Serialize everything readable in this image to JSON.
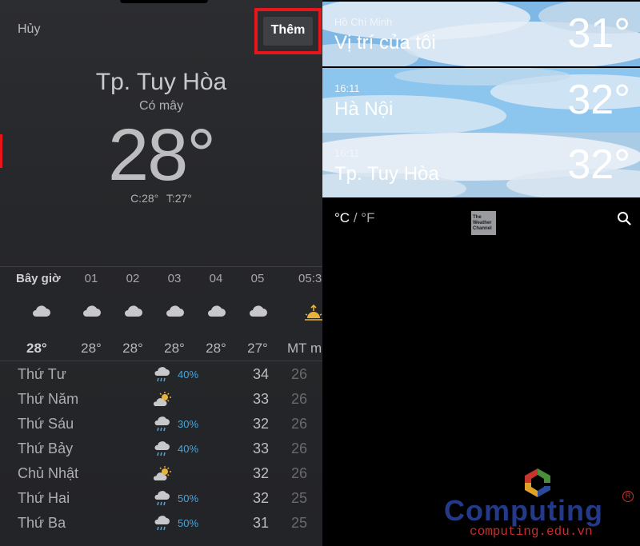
{
  "left_panel": {
    "cancel_label": "Hủy",
    "add_label": "Thêm",
    "city": "Tp. Tuy Hòa",
    "condition": "Có mây",
    "current_temp": "28°",
    "hi_lo": "C:28°  T:27°",
    "hourly": [
      {
        "label": "Bây giờ",
        "icon": "cloud-icon",
        "temp": "28°"
      },
      {
        "label": "01",
        "icon": "cloud-icon",
        "temp": "28°"
      },
      {
        "label": "02",
        "icon": "cloud-icon",
        "temp": "28°"
      },
      {
        "label": "03",
        "icon": "cloud-icon",
        "temp": "28°"
      },
      {
        "label": "04",
        "icon": "cloud-icon",
        "temp": "28°"
      },
      {
        "label": "05",
        "icon": "cloud-icon",
        "temp": "27°"
      },
      {
        "label": "05:3",
        "icon": "sunrise-icon",
        "temp": "MT m"
      }
    ],
    "daily": [
      {
        "day": "Thứ Tư",
        "icon": "rain-icon",
        "precip": "40%",
        "high": "34",
        "low": "26"
      },
      {
        "day": "Thứ Năm",
        "icon": "sun-cloud-icon",
        "precip": "",
        "high": "33",
        "low": "26"
      },
      {
        "day": "Thứ Sáu",
        "icon": "rain-icon",
        "precip": "30%",
        "high": "32",
        "low": "26"
      },
      {
        "day": "Thứ Bảy",
        "icon": "rain-icon",
        "precip": "40%",
        "high": "33",
        "low": "26"
      },
      {
        "day": "Chủ Nhật",
        "icon": "sun-cloud-icon",
        "precip": "",
        "high": "32",
        "low": "26"
      },
      {
        "day": "Thứ Hai",
        "icon": "rain-icon",
        "precip": "50%",
        "high": "32",
        "low": "25"
      },
      {
        "day": "Thứ Ba",
        "icon": "rain-icon",
        "precip": "50%",
        "high": "31",
        "low": "25"
      }
    ]
  },
  "right_panel": {
    "cards": [
      {
        "subtitle": "Hồ Chí Minh",
        "name": "Vị trí của tôi",
        "temp": "31°"
      },
      {
        "subtitle": "16:11",
        "name": "Hà Nội",
        "temp": "32°"
      },
      {
        "subtitle": "16:11",
        "name": "Tp. Tuy Hòa",
        "temp": "32°"
      }
    ],
    "unit_celsius": "°C",
    "unit_sep": "/",
    "unit_fahrenheit": "°F",
    "provider_logo": "The Weather Channel"
  },
  "watermark": {
    "brand": "Computing",
    "url": "computing.edu.vn"
  },
  "colors": {
    "highlight": "#e8161a",
    "precip": "#4aa3d8",
    "sky": "#8ec2ea"
  }
}
